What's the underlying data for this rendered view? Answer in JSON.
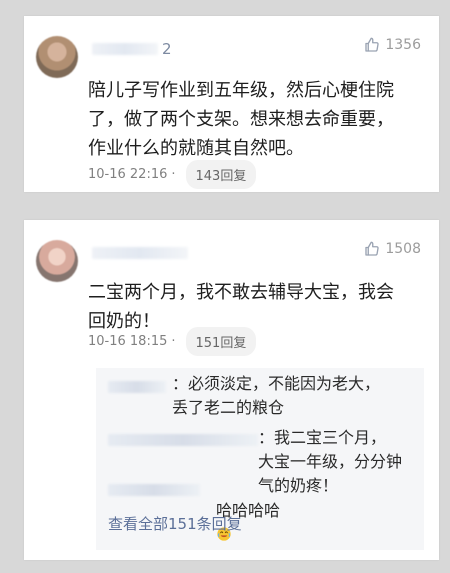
{
  "comments": [
    {
      "name_suffix": "2",
      "likes": "1356",
      "text": "陪儿子写作业到五年级，然后心梗住院\n了，做了两个支架。想来想去命重要，\n作业什么的就随其自然吧。",
      "time": "10-16 22:16",
      "separator": "·",
      "replies": "143回复"
    },
    {
      "likes": "1508",
      "text": "二宝两个月，我不敢去辅导大宝，我会\n回奶的！",
      "time": "10-16 18:15",
      "separator": "·",
      "replies": "151回复",
      "sub_replies": [
        {
          "text": "：必须淡定，不能因为老大，\n丢了老二的粮仓"
        },
        {
          "text": "：我二宝三个月，\n大宝一年级，分分钟气的奶疼！"
        },
        {
          "text": "哈哈哈哈"
        }
      ],
      "view_all": "查看全部151条回复"
    }
  ],
  "colors": {
    "background": "#d8d8d8",
    "card": "#ffffff",
    "link": "#5b6f98",
    "muted": "#808080"
  }
}
